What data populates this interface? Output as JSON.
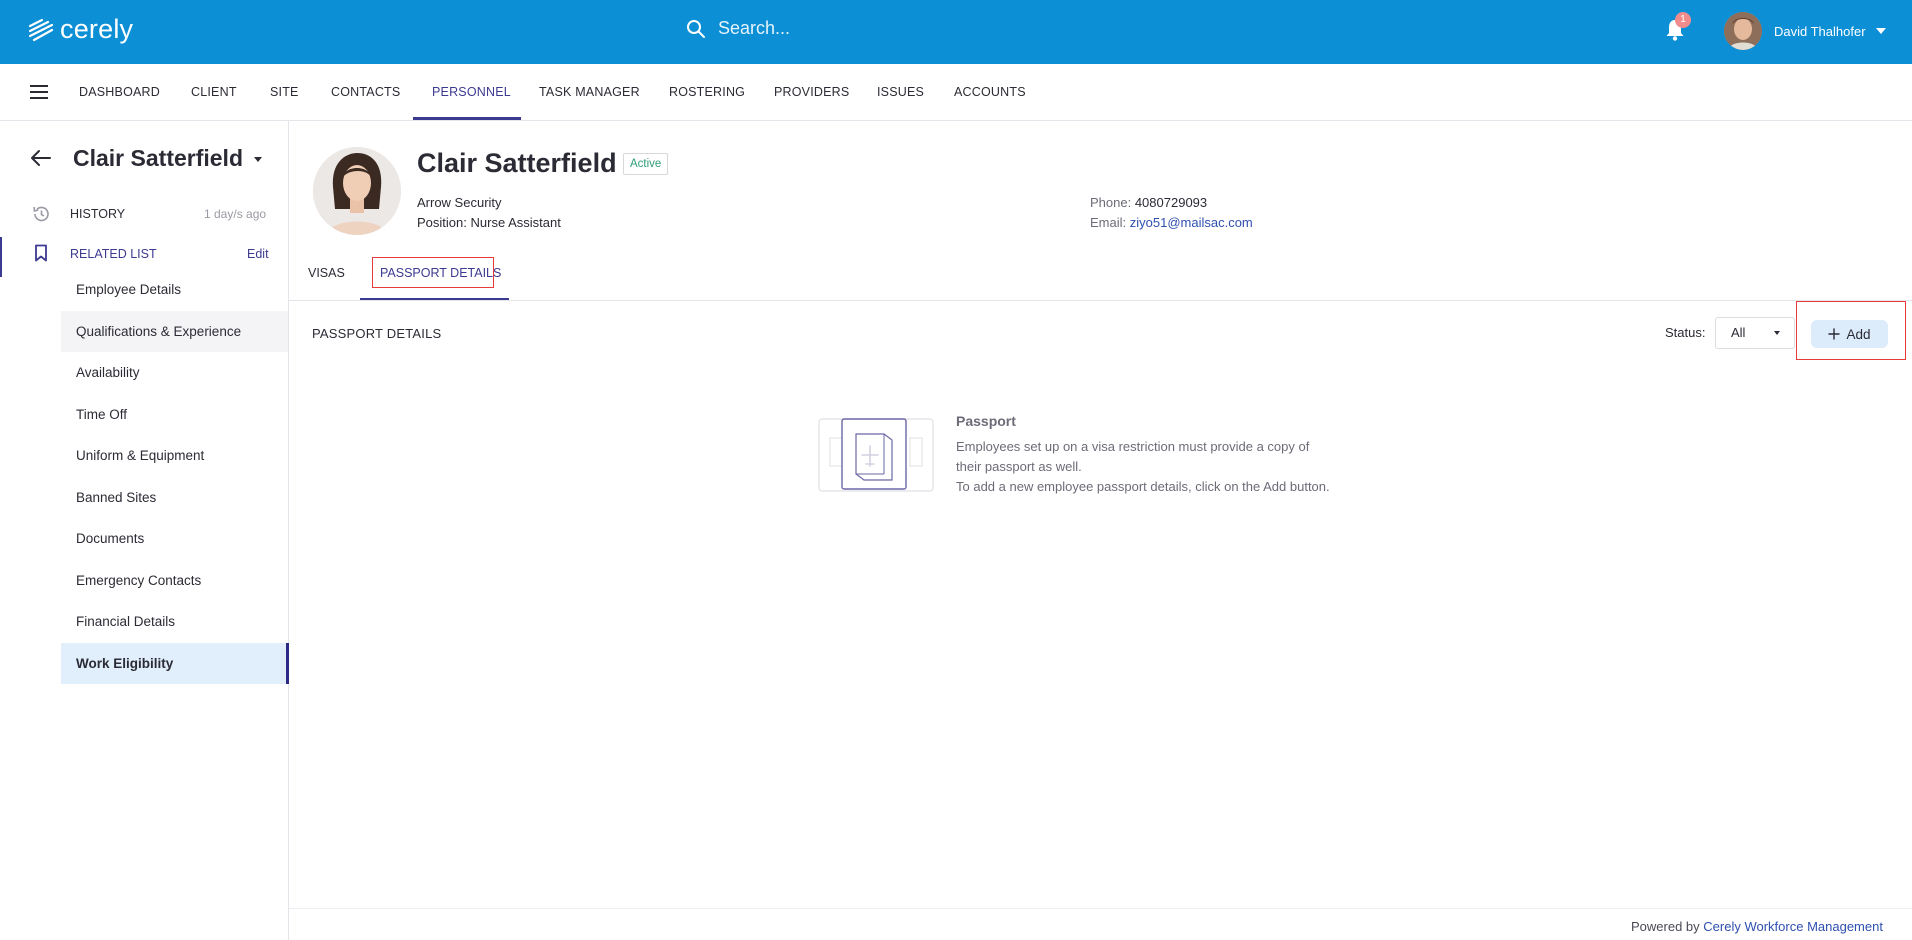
{
  "app": {
    "logo_text": "cerely"
  },
  "search": {
    "placeholder": "Search..."
  },
  "notifications": {
    "count": "1"
  },
  "user": {
    "name": "David Thalhofer"
  },
  "nav": {
    "items": [
      "DASHBOARD",
      "CLIENT",
      "SITE",
      "CONTACTS",
      "PERSONNEL",
      "TASK MANAGER",
      "ROSTERING",
      "PROVIDERS",
      "ISSUES",
      "ACCOUNTS"
    ],
    "active": "PERSONNEL"
  },
  "sidebar": {
    "title": "Clair Satterfield",
    "history_label": "HISTORY",
    "history_time": "1 day/s ago",
    "related_label": "RELATED LIST",
    "edit_label": "Edit",
    "items": [
      "Employee Details",
      "Qualifications & Experience",
      "Availability",
      "Time Off",
      "Uniform & Equipment",
      "Banned Sites",
      "Documents",
      "Emergency Contacts",
      "Financial Details",
      "Work Eligibility"
    ],
    "active_item": "Work Eligibility"
  },
  "profile": {
    "name": "Clair Satterfield",
    "status": "Active",
    "company": "Arrow Security",
    "position_label": "Position:",
    "position_value": "Nurse Assistant",
    "phone_label": "Phone:",
    "phone_value": "4080729093",
    "email_label": "Email:",
    "email_value": "ziyo51@mailsac.com"
  },
  "tabs": {
    "visas": "VISAS",
    "passport": "PASSPORT DETAILS",
    "active": "PASSPORT DETAILS"
  },
  "section": {
    "title": "PASSPORT DETAILS",
    "status_label": "Status:",
    "status_value": "All",
    "add_label": "Add"
  },
  "empty_state": {
    "title": "Passport",
    "line1": "Employees set up on a visa restriction must provide a copy of",
    "line2": "their passport as well.",
    "line3": "To add a new employee passport details, click on the Add button."
  },
  "footer": {
    "prefix": "Powered by",
    "link": "Cerely Workforce Management"
  },
  "colors": {
    "topbar": "#0d8fd6",
    "accent": "#3d3a91",
    "highlight_box": "#e53b3b",
    "active_item_bg": "#e1eefb"
  }
}
